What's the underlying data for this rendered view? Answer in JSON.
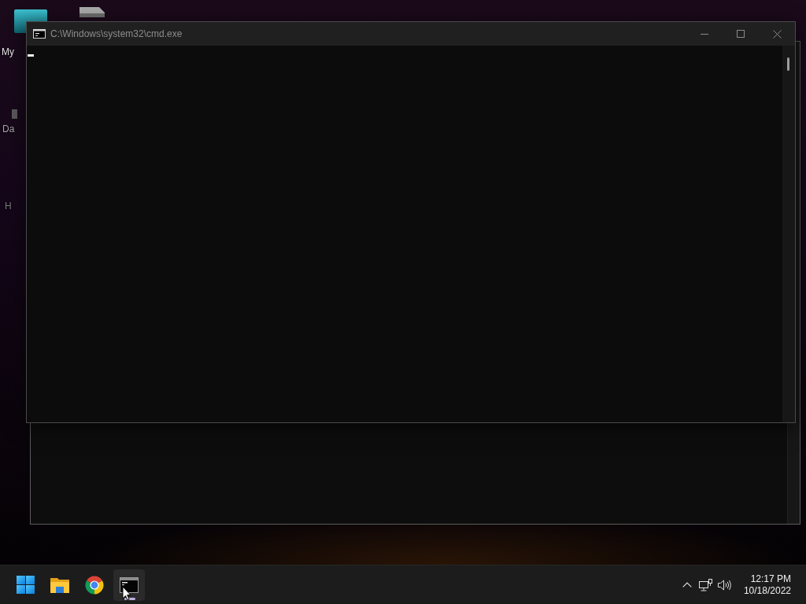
{
  "desktop": {
    "icons": [
      {
        "label": "My"
      },
      {
        "label": "Da"
      },
      {
        "label": "H"
      }
    ]
  },
  "console_window": {
    "title": "C:\\Windows\\system32\\cmd.exe"
  },
  "taskbar": {
    "apps": [
      {
        "kind": "start",
        "running": false
      },
      {
        "kind": "folder",
        "running": false
      },
      {
        "kind": "browser",
        "running": false
      },
      {
        "kind": "terminal",
        "running": true
      }
    ],
    "clock": {
      "time": "12:17 PM",
      "date": "10/18/2022"
    }
  }
}
